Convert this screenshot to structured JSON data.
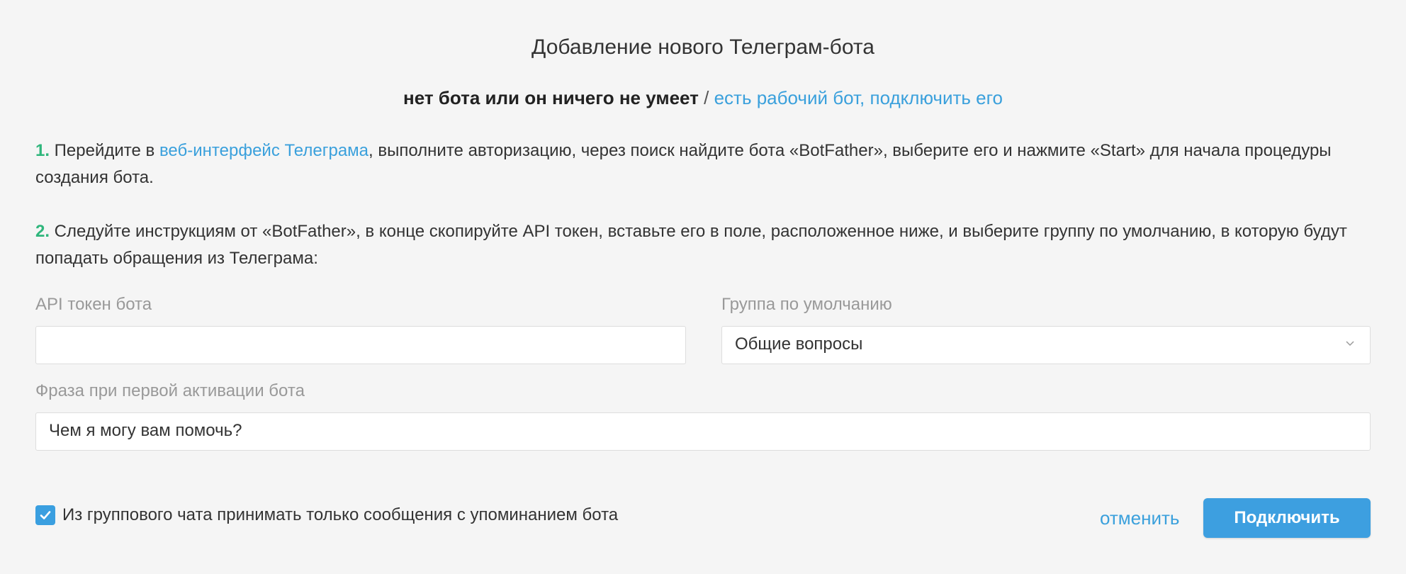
{
  "dialog": {
    "title": "Добавление нового Телеграм-бота"
  },
  "mode_switch": {
    "current": "нет бота или он ничего не умеет",
    "separator": " / ",
    "alternative": "есть рабочий бот, подключить его"
  },
  "steps": [
    {
      "number": "1.",
      "text_before": " Перейдите в ",
      "link": "веб-интерфейс Телеграма",
      "text_after": ", выполните авторизацию, через поиск найдите бота «BotFather», выберите его и нажмите «Start» для начала процедуры создания бота."
    },
    {
      "number": "2.",
      "text": " Следуйте инструкциям от «BotFather», в конце скопируйте API токен, вставьте его в поле, расположенное ниже, и выберите группу по умолчанию, в которую будут попадать обращения из Телеграма:"
    }
  ],
  "form": {
    "token_label": "API токен бота",
    "token_value": "",
    "group_label": "Группа по умолчанию",
    "group_selected": "Общие вопросы",
    "phrase_label": "Фраза при первой активации бота",
    "phrase_value": "Чем я могу вам помочь?"
  },
  "options": {
    "mention_only_label": "Из группового чата принимать только сообщения с упоминанием бота",
    "mention_only_checked": true
  },
  "actions": {
    "cancel_label": "отменить",
    "connect_label": "Подключить"
  },
  "icons": {
    "select_chevron": "chevron-down-icon",
    "checkbox_check": "check-icon"
  },
  "colors": {
    "accent": "#3aa0dc",
    "step_number": "#2fb67c",
    "button": "#3d9fe0",
    "background": "#f5f5f5"
  }
}
